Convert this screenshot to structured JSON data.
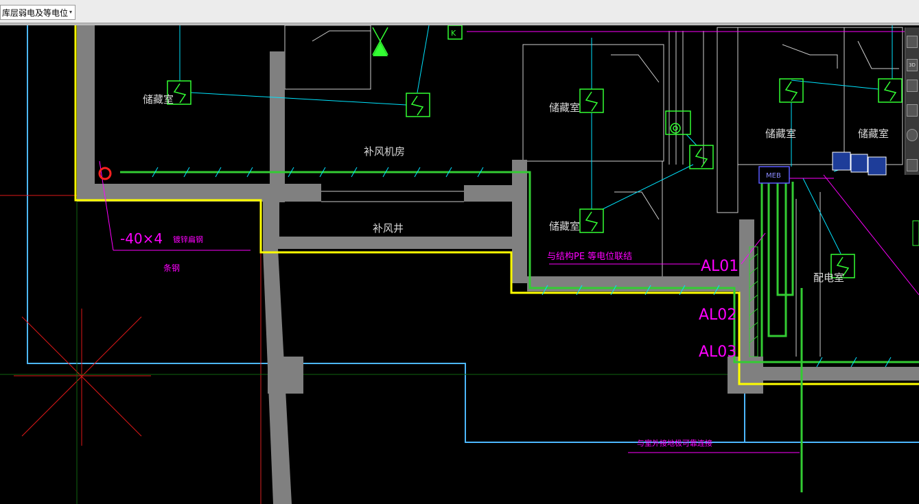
{
  "toolbar": {
    "layer_name": "库层弱电及等电位",
    "dropdown_arrow": "▾"
  },
  "drawing": {
    "rooms": {
      "storage_1": "储藏室",
      "storage_2": "储藏室",
      "storage_3": "储藏室",
      "storage_4": "储藏室",
      "storage_5": "储藏室",
      "fan_room": "补风机房",
      "shaft": "补风井",
      "power_room": "配电室"
    },
    "annotations": {
      "steel_bar": "-40×4",
      "steel_bar_tail": "镀锌扁钢",
      "cable_note": "与结构PE 等电位联结",
      "bottom_note": "与室外接地极可靠连接",
      "lower_note": "条钢"
    },
    "feeders": [
      "AL01",
      "AL02",
      "AL03"
    ],
    "meb_label": "MEB",
    "nav": {
      "view_3d": "3D"
    }
  },
  "colors": {
    "wall": "#808080",
    "boundary": "#ffff00",
    "ground_line": "#33cc33",
    "annotation": "#ff00ff",
    "cyan_wire": "#00e5ff",
    "device": "#33ff33",
    "room_outline": "#d0d0d0"
  }
}
